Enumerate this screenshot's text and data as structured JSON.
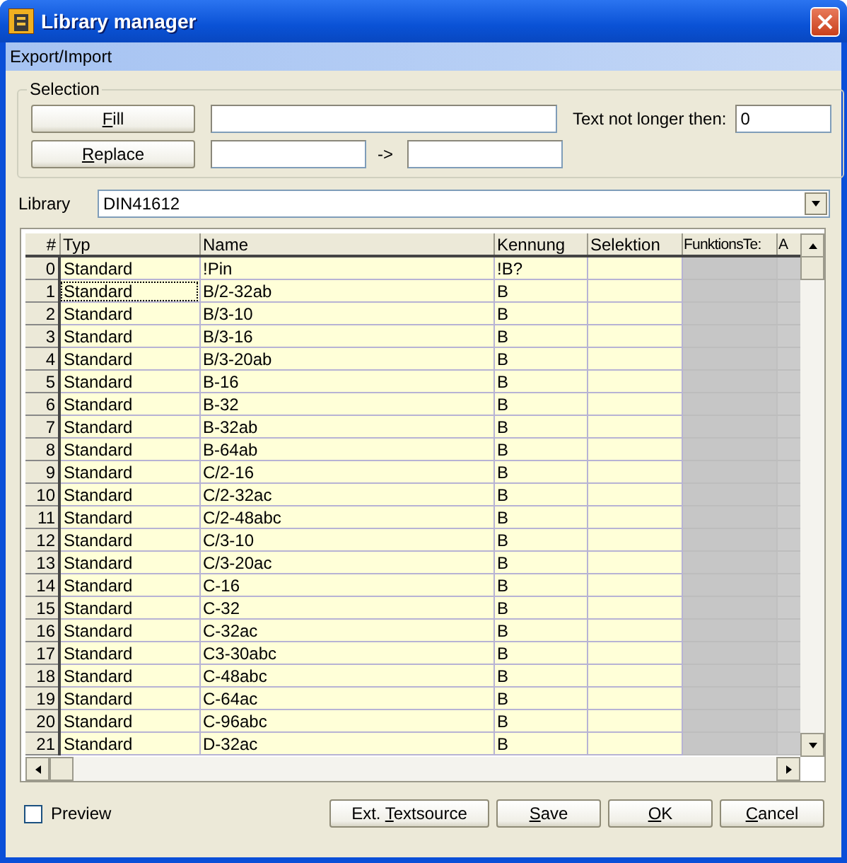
{
  "window": {
    "title": "Library manager"
  },
  "menu": [
    {
      "label": "Export/Import"
    }
  ],
  "selection": {
    "title": "Selection",
    "fill_button": {
      "key": "F",
      "post": "ill"
    },
    "replace_button": {
      "key": "R",
      "post": "eplace"
    },
    "arrow": "->",
    "max_length_label": "Text not longer then:",
    "max_length_value": "0"
  },
  "library": {
    "label": "Library",
    "value": "DIN41612"
  },
  "table": {
    "columns": [
      "#",
      "Typ",
      "Name",
      "Kennung",
      "Selektion",
      "FunktionsTe:",
      "A"
    ],
    "rows": [
      {
        "cells": [
          "0",
          "Standard",
          "!Pin",
          "!B?",
          ""
        ],
        "focused": false
      },
      {
        "cells": [
          "1",
          "Standard",
          "B/2-32ab",
          "B",
          ""
        ],
        "focused": true
      },
      {
        "cells": [
          "2",
          "Standard",
          "B/3-10",
          "B",
          ""
        ],
        "focused": false
      },
      {
        "cells": [
          "3",
          "Standard",
          "B/3-16",
          "B",
          ""
        ],
        "focused": false
      },
      {
        "cells": [
          "4",
          "Standard",
          "B/3-20ab",
          "B",
          ""
        ],
        "focused": false
      },
      {
        "cells": [
          "5",
          "Standard",
          "B-16",
          "B",
          ""
        ],
        "focused": false
      },
      {
        "cells": [
          "6",
          "Standard",
          "B-32",
          "B",
          ""
        ],
        "focused": false
      },
      {
        "cells": [
          "7",
          "Standard",
          "B-32ab",
          "B",
          ""
        ],
        "focused": false
      },
      {
        "cells": [
          "8",
          "Standard",
          "B-64ab",
          "B",
          ""
        ],
        "focused": false
      },
      {
        "cells": [
          "9",
          "Standard",
          "C/2-16",
          "B",
          ""
        ],
        "focused": false
      },
      {
        "cells": [
          "10",
          "Standard",
          "C/2-32ac",
          "B",
          ""
        ],
        "focused": false
      },
      {
        "cells": [
          "11",
          "Standard",
          "C/2-48abc",
          "B",
          ""
        ],
        "focused": false
      },
      {
        "cells": [
          "12",
          "Standard",
          "C/3-10",
          "B",
          ""
        ],
        "focused": false
      },
      {
        "cells": [
          "13",
          "Standard",
          "C/3-20ac",
          "B",
          ""
        ],
        "focused": false
      },
      {
        "cells": [
          "14",
          "Standard",
          "C-16",
          "B",
          ""
        ],
        "focused": false
      },
      {
        "cells": [
          "15",
          "Standard",
          "C-32",
          "B",
          ""
        ],
        "focused": false
      },
      {
        "cells": [
          "16",
          "Standard",
          "C-32ac",
          "B",
          ""
        ],
        "focused": false
      },
      {
        "cells": [
          "17",
          "Standard",
          "C3-30abc",
          "B",
          ""
        ],
        "focused": false
      },
      {
        "cells": [
          "18",
          "Standard",
          "C-48abc",
          "B",
          ""
        ],
        "focused": false
      },
      {
        "cells": [
          "19",
          "Standard",
          "C-64ac",
          "B",
          ""
        ],
        "focused": false
      },
      {
        "cells": [
          "20",
          "Standard",
          "C-96abc",
          "B",
          ""
        ],
        "focused": false
      },
      {
        "cells": [
          "21",
          "Standard",
          "D-32ac",
          "B",
          ""
        ],
        "focused": false
      }
    ]
  },
  "preview": {
    "label": "Preview",
    "checked": false
  },
  "buttons": [
    {
      "pre": "Ext. ",
      "key": "T",
      "post": "extsource"
    },
    {
      "key": "S",
      "post": "ave"
    },
    {
      "key": "O",
      "post": "K"
    },
    {
      "key": "C",
      "post": "ancel"
    }
  ]
}
